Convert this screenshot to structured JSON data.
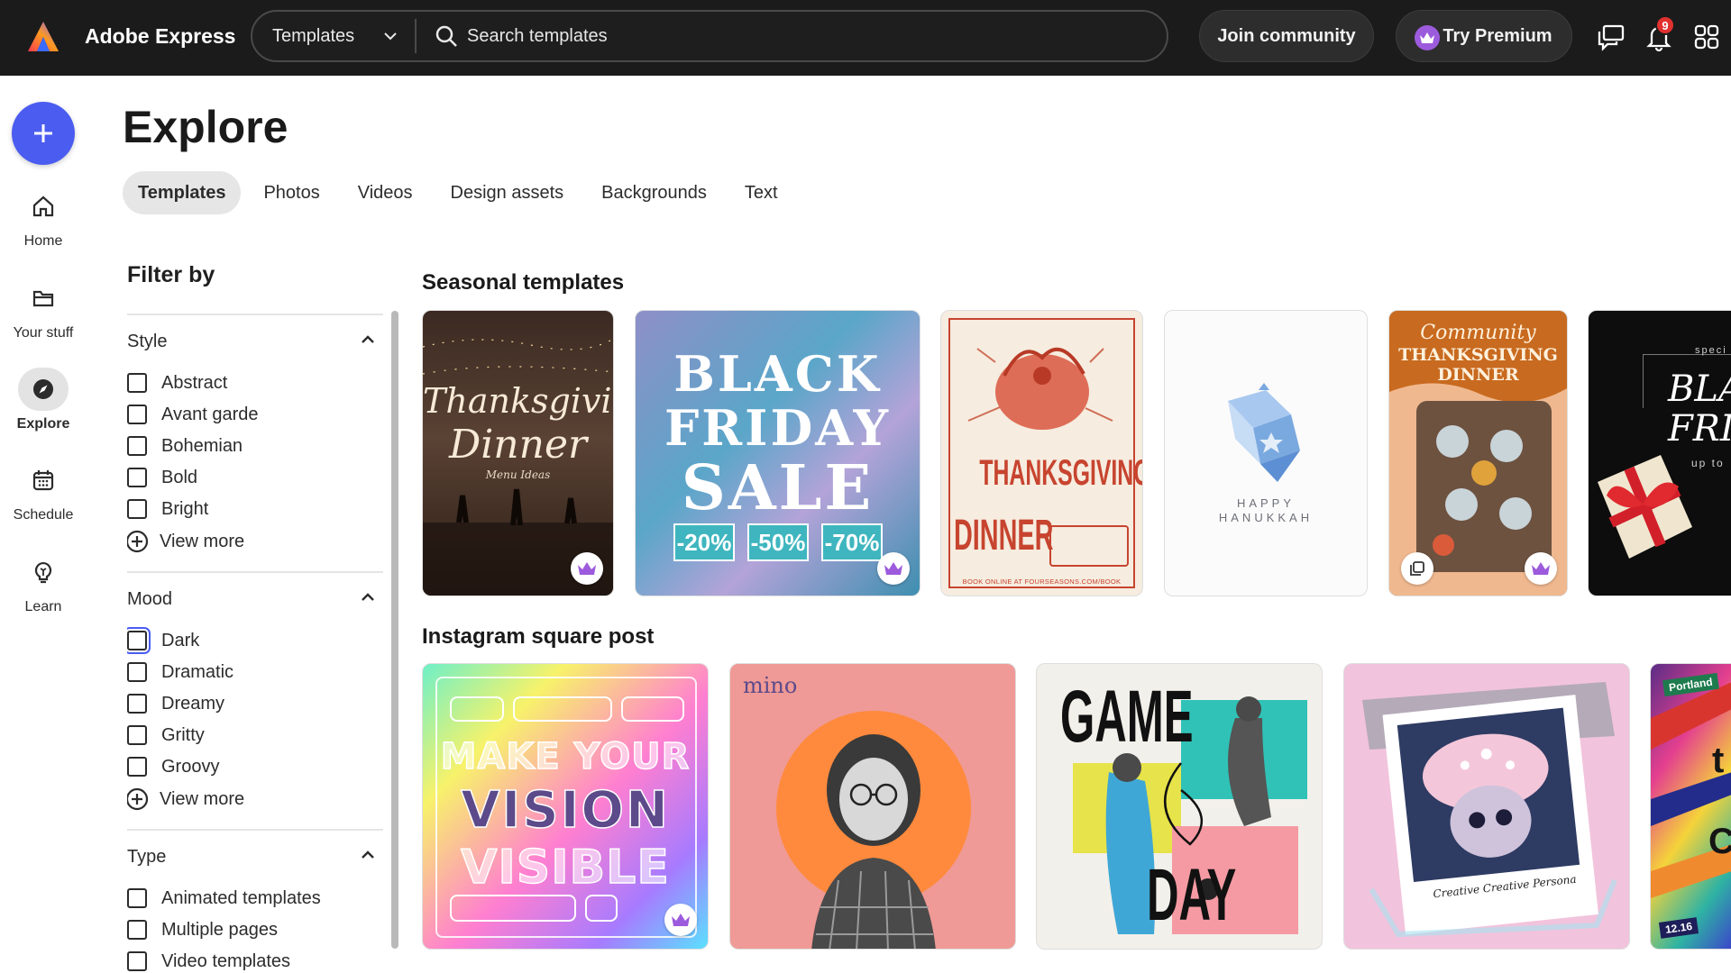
{
  "header": {
    "app_name": "Adobe Express",
    "search": {
      "category": "Templates",
      "placeholder": "Search templates"
    },
    "join_label": "Join community",
    "premium_label": "Try Premium",
    "notification_count": "9"
  },
  "rail": {
    "items": [
      {
        "label": "Home",
        "icon": "home-icon"
      },
      {
        "label": "Your stuff",
        "icon": "folder-icon"
      },
      {
        "label": "Explore",
        "icon": "compass-icon",
        "active": true
      },
      {
        "label": "Schedule",
        "icon": "calendar-icon"
      },
      {
        "label": "Learn",
        "icon": "lightbulb-icon"
      }
    ]
  },
  "page": {
    "title": "Explore",
    "tabs": [
      "Templates",
      "Photos",
      "Videos",
      "Design assets",
      "Backgrounds",
      "Text"
    ],
    "active_tab": "Templates"
  },
  "filters": {
    "title": "Filter by",
    "sections": [
      {
        "title": "Style",
        "items": [
          "Abstract",
          "Avant garde",
          "Bohemian",
          "Bold",
          "Bright"
        ],
        "view_more": "View more"
      },
      {
        "title": "Mood",
        "items": [
          "Dark",
          "Dramatic",
          "Dreamy",
          "Gritty",
          "Groovy"
        ],
        "view_more": "View more"
      },
      {
        "title": "Type",
        "items": [
          "Animated templates",
          "Multiple pages",
          "Video templates"
        ]
      }
    ]
  },
  "sections": {
    "seasonal": {
      "title": "Seasonal templates",
      "cards": {
        "thanksgiving_script": {
          "line1": "Thanksgiving",
          "line2": "Dinner",
          "sub": "Menu Ideas"
        },
        "black_friday": {
          "line1": "BLACK",
          "line2": "FRIDAY",
          "line3": "SALE",
          "discounts": [
            "-20%",
            "-50%",
            "-70%"
          ]
        },
        "thanksgiving_poster": {
          "line1": "THANKSGIVING",
          "line2": "DINNER",
          "footer": "BOOK ONLINE AT FOURSEASONS.COM/BOOK"
        },
        "hanukkah": {
          "line1": "HAPPY",
          "line2": "HANUKKAH"
        },
        "community_dinner": {
          "line1": "Community",
          "line2": "THANKSGIVING",
          "line3": "DINNER"
        },
        "black_friday_gift": {
          "kicker": "speci",
          "line1": "BLA",
          "line2": "FRI",
          "sub": "up to"
        }
      }
    },
    "instagram": {
      "title": "Instagram square post",
      "cards": {
        "vision": {
          "line1": "MAKE YOUR",
          "line2": "VISION",
          "line3": "VISIBLE"
        },
        "mino": {
          "brand": "mino"
        },
        "gameday": {
          "line1": "GAME",
          "line2": "DAY"
        },
        "persona": {
          "caption": "Creative Creative Persona"
        },
        "portland": {
          "tag": "Portland",
          "date": "12.16"
        }
      }
    }
  },
  "colors": {
    "topbar": "#1b1b1b",
    "create_button": "#4b5cf0",
    "premium_crown": "#9c5bdc",
    "notification_badge": "#e0312f"
  }
}
